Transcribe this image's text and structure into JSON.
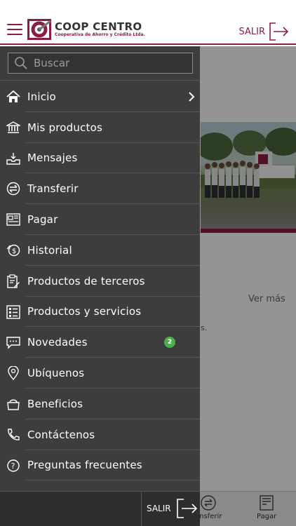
{
  "header": {
    "logo_name": "COOP CENTRO",
    "logo_sub": "Cooperativa de Ahorro y Crédito Ltda.",
    "salir_label": "SALIR"
  },
  "search": {
    "placeholder": "Buscar"
  },
  "menu": {
    "items": [
      {
        "label": "Inicio",
        "icon": "home-icon"
      },
      {
        "label": "Mis productos",
        "icon": "bank-icon"
      },
      {
        "label": "Mensajes",
        "icon": "inbox-icon"
      },
      {
        "label": "Transferir",
        "icon": "transfer-icon"
      },
      {
        "label": "Pagar",
        "icon": "pay-icon"
      },
      {
        "label": "Historial",
        "icon": "history-icon"
      },
      {
        "label": "Productos de terceros",
        "icon": "clipboard-icon"
      },
      {
        "label": "Productos y servicios",
        "icon": "list-icon"
      },
      {
        "label": "Novedades",
        "icon": "chat-icon",
        "badge": "2"
      },
      {
        "label": "Ubíquenos",
        "icon": "location-pin-icon"
      },
      {
        "label": "Beneficios",
        "icon": "bag-icon"
      },
      {
        "label": "Contáctenos",
        "icon": "phone-icon"
      },
      {
        "label": "Preguntas frecuentes",
        "icon": "question-icon"
      }
    ]
  },
  "drawer_footer": {
    "salir_label": "SALIR"
  },
  "background": {
    "ver_mas": "Ver más",
    "ellipsis": "s.",
    "bottom_nav": [
      {
        "label": "ansferir",
        "icon": "transfer-icon"
      },
      {
        "label": "Pagar",
        "icon": "pay-icon"
      }
    ]
  },
  "colors": {
    "brand": "#8b1d41",
    "drawer_bg": "#3d3d3d",
    "badge": "#4cae4c"
  }
}
